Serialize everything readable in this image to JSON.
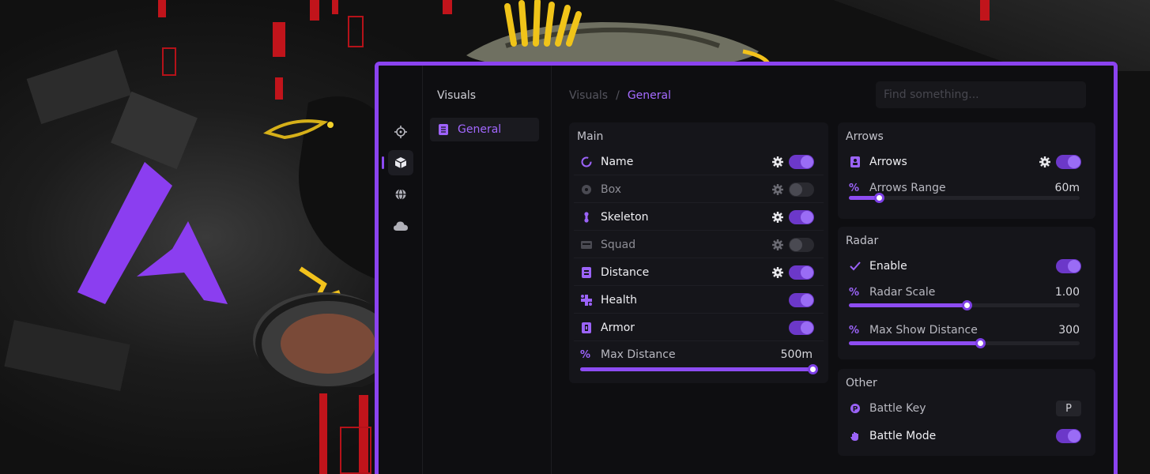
{
  "colors": {
    "accent": "#8b43f0",
    "accent_text": "#a56bff",
    "window_bg": "#0e0e11",
    "card_bg": "#15151a",
    "toggle_on": "#6c38c9",
    "toggle_off": "#2a2a30"
  },
  "rail": {
    "items": [
      {
        "icon": "crosshair-icon",
        "active": false
      },
      {
        "icon": "cube-icon",
        "active": true
      },
      {
        "icon": "globe-icon",
        "active": false
      },
      {
        "icon": "cloud-icon",
        "active": false
      }
    ]
  },
  "nav": {
    "title": "Visuals",
    "items": [
      {
        "label": "General",
        "icon": "document-icon",
        "selected": true
      }
    ]
  },
  "breadcrumb": {
    "parent": "Visuals",
    "separator": "/",
    "current": "General"
  },
  "search": {
    "placeholder": "Find something..."
  },
  "main": {
    "title": "Main",
    "rows": [
      {
        "label": "Name",
        "icon": "circle-icon",
        "gear": true,
        "enabled": true
      },
      {
        "label": "Box",
        "icon": "target-icon",
        "gear": true,
        "enabled": false
      },
      {
        "label": "Skeleton",
        "icon": "bone-icon",
        "gear": true,
        "enabled": true
      },
      {
        "label": "Squad",
        "icon": "card-icon",
        "gear": true,
        "enabled": false
      },
      {
        "label": "Distance",
        "icon": "ruler-icon",
        "gear": true,
        "enabled": true
      },
      {
        "label": "Health",
        "icon": "health-icon",
        "gear": false,
        "enabled": true
      },
      {
        "label": "Armor",
        "icon": "armor-icon",
        "gear": false,
        "enabled": true
      }
    ],
    "slider": {
      "label": "Max Distance",
      "value_text": "500m",
      "fraction": 1.0
    }
  },
  "arrows": {
    "title": "Arrows",
    "row": {
      "label": "Arrows",
      "icon": "person-icon",
      "gear": true,
      "enabled": true
    },
    "slider": {
      "label": "Arrows Range",
      "value_text": "60m",
      "fraction": 0.13
    }
  },
  "radar": {
    "title": "Radar",
    "row": {
      "label": "Enable",
      "icon": "check-icon",
      "enabled": true
    },
    "sliders": [
      {
        "label": "Radar Scale",
        "value_text": "1.00",
        "fraction": 0.51
      },
      {
        "label": "Max Show Distance",
        "value_text": "300",
        "fraction": 0.57
      }
    ]
  },
  "other": {
    "title": "Other",
    "battle_key": {
      "label": "Battle Key",
      "icon": "key-icon",
      "key": "P"
    },
    "battle_mode": {
      "label": "Battle Mode",
      "icon": "hand-icon",
      "enabled": true
    }
  }
}
